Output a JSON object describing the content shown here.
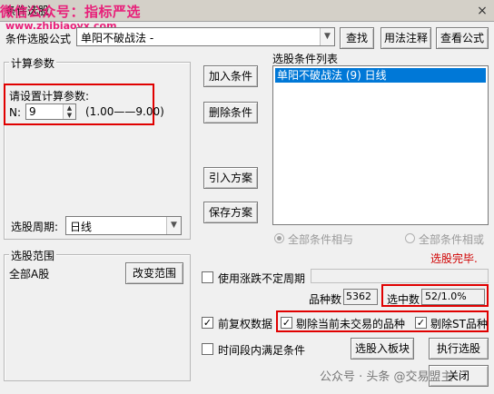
{
  "window": {
    "title": "条件选股",
    "watermark_top": "微信公众号：指标严选",
    "watermark_url": "www.zhibiaoyx.com",
    "close": "×"
  },
  "formula": {
    "label": "条件选股公式",
    "value": "单阳不破战法 -",
    "buttons": {
      "find": "查找",
      "usage": "用法注释",
      "view": "查看公式"
    }
  },
  "params": {
    "group_title": "计算参数",
    "prompt": "请设置计算参数:",
    "n_label": "N:",
    "n_value": "9",
    "range": "(1.00——9.00)"
  },
  "period": {
    "label": "选股周期:",
    "value": "日线"
  },
  "actions": {
    "add": "加入条件",
    "delete": "删除条件",
    "import": "引入方案",
    "save": "保存方案"
  },
  "conditions": {
    "title": "选股条件列表",
    "items": [
      "单阳不破战法 (9) 日线"
    ],
    "radio_and": "全部条件相与",
    "radio_or": "全部条件相或",
    "status": "选股完毕."
  },
  "scope": {
    "group_title": "选股范围",
    "value": "全部A股",
    "change": "改变范围"
  },
  "options": {
    "zdt_label": "使用涨跌不定周期",
    "count_label": "品种数",
    "count_value": "5362",
    "selected_label": "选中数",
    "selected_value": "52/1.0%",
    "fq_label": "前复权数据",
    "exclude_untraded": "剔除当前未交易的品种",
    "exclude_st": "剔除ST品种",
    "time_range": "时间段内满足条件",
    "check_mark": "✓"
  },
  "bottom": {
    "to_block": "选股入板块",
    "execute": "执行选股",
    "close": "关闭",
    "footer_watermark": "公众号 · 头条 @交易盟主"
  },
  "colors": {
    "highlight_red": "#e00000",
    "selection_blue": "#0078d7",
    "status_red": "#d00000",
    "watermark_pink": "#e8207a"
  }
}
